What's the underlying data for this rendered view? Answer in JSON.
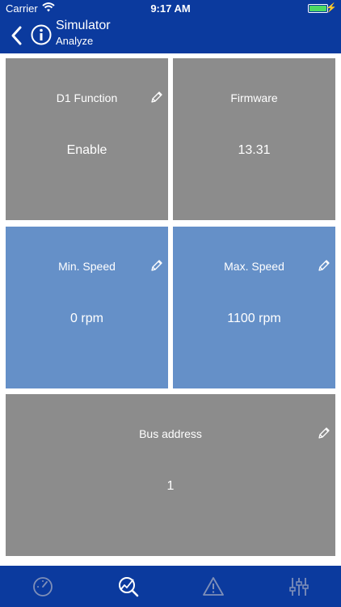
{
  "status_bar": {
    "carrier": "Carrier",
    "time": "9:17 AM",
    "battery_level": 1.0
  },
  "header": {
    "title": "Simulator",
    "subtitle": "Analyze"
  },
  "tiles": [
    {
      "label": "D1 Function",
      "value": "Enable",
      "editable": true,
      "color": "#8c8c8c"
    },
    {
      "label": "Firmware",
      "value": "13.31",
      "editable": false,
      "color": "#8c8c8c"
    },
    {
      "label": "Min. Speed",
      "value": "0 rpm",
      "editable": true,
      "color": "#6590c8"
    },
    {
      "label": "Max. Speed",
      "value": "1100 rpm",
      "editable": true,
      "color": "#6590c8"
    },
    {
      "label": "Bus address",
      "value": "1",
      "editable": true,
      "color": "#8c8c8c"
    }
  ],
  "tabbar": {
    "tabs": [
      {
        "icon": "gauge-icon",
        "active": false
      },
      {
        "icon": "analyze-icon",
        "active": true
      },
      {
        "icon": "warning-icon",
        "active": false
      },
      {
        "icon": "sliders-icon",
        "active": false
      }
    ]
  },
  "colors": {
    "header": "#0b3a9e",
    "tile_gray": "#8c8c8c",
    "tile_blue": "#6590c8",
    "tab_inactive": "#7f8fb8",
    "tab_active": "#ffffff"
  }
}
